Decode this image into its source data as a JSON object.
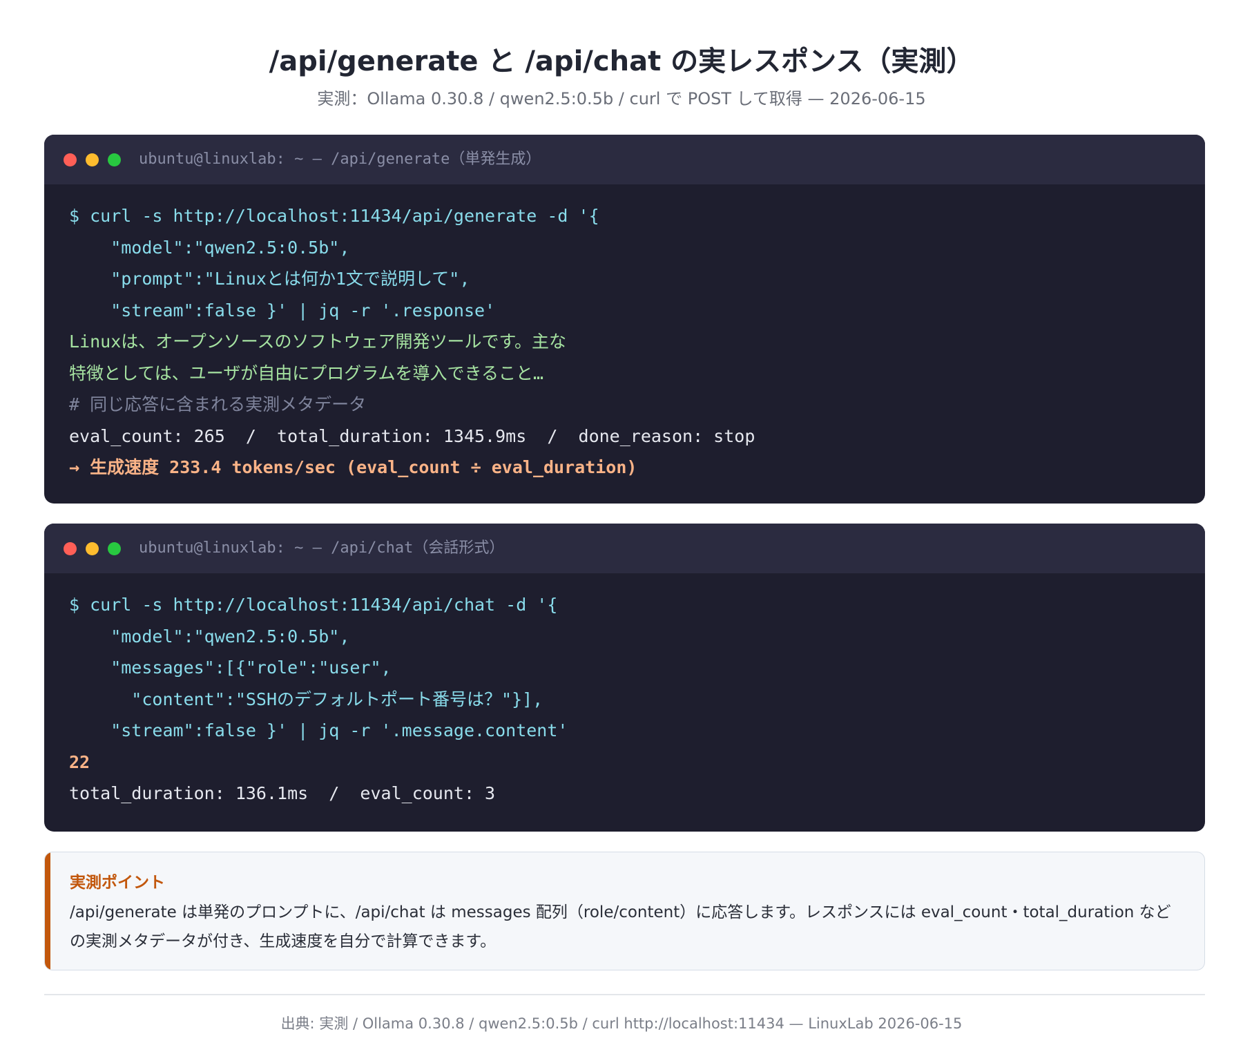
{
  "header": {
    "title": "/api/generate と /api/chat の実レスポンス（実測）",
    "subtitle": "実測：Ollama 0.30.8 / qwen2.5:0.5b / curl で POST して取得 — 2026-06-15"
  },
  "terminal_generate": {
    "title": "ubuntu@linuxlab: ~ — /api/generate（単発生成）",
    "lines": [
      "$ curl -s http://localhost:11434/api/generate -d '{",
      "    \"model\":\"qwen2.5:0.5b\",",
      "    \"prompt\":\"Linuxとは何か1文で説明して\",",
      "    \"stream\":false }' | jq -r '.response'",
      "Linuxは、オープンソースのソフトウェア開発ツールです。主な",
      "特徴としては、ユーザが自由にプログラムを導入できること…",
      "# 同じ応答に含まれる実測メタデータ",
      "eval_count: 265  /  total_duration: 1345.9ms  /  done_reason: stop",
      "→ 生成速度 233.4 tokens/sec (eval_count ÷ eval_duration)"
    ]
  },
  "terminal_chat": {
    "title": "ubuntu@linuxlab: ~ — /api/chat（会話形式）",
    "lines": [
      "$ curl -s http://localhost:11434/api/chat -d '{",
      "    \"model\":\"qwen2.5:0.5b\",",
      "    \"messages\":[{\"role\":\"user\",",
      "      \"content\":\"SSHのデフォルトポート番号は？\"}],",
      "    \"stream\":false }' | jq -r '.message.content'",
      "22",
      "total_duration: 136.1ms  /  eval_count: 3"
    ]
  },
  "callout": {
    "title": "実測ポイント",
    "text": "/api/generate は単発のプロンプトに、/api/chat は messages 配列（role/content）に応答します。レスポンスには eval_count・total_duration などの実測メタデータが付き、生成速度を自分で計算できます。"
  },
  "footer": {
    "source": "出典: 実測 / Ollama 0.30.8 / qwen2.5:0.5b / curl http://localhost:11434 — LinuxLab 2026-06-15"
  },
  "colors": {
    "accent": "#c2570c",
    "terminal_bg": "#1e1e2e",
    "command": "#89dceb",
    "output": "#a6e3a1",
    "highlight": "#fab387"
  }
}
